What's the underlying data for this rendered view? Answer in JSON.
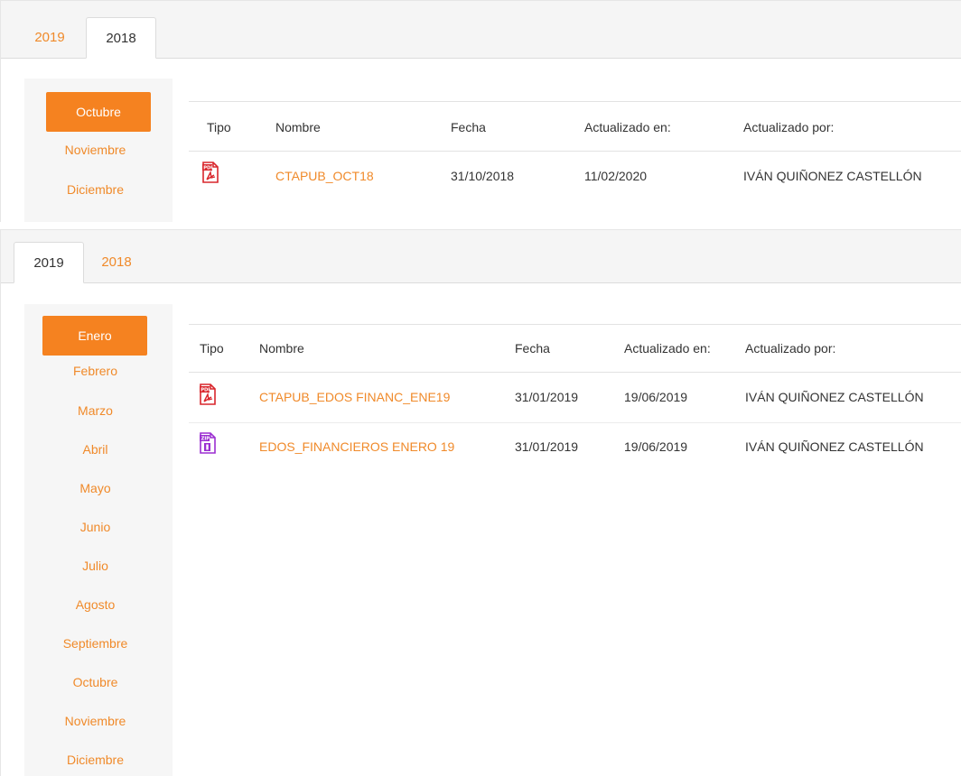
{
  "panel1": {
    "tabs": [
      {
        "label": "2019",
        "active": false
      },
      {
        "label": "2018",
        "active": true
      }
    ],
    "months": [
      "Octubre",
      "Noviembre",
      "Diciembre"
    ],
    "active_month": "Octubre",
    "columns": [
      "Tipo",
      "Nombre",
      "Fecha",
      "Actualizado en:",
      "Actualizado por:"
    ],
    "rows": [
      {
        "type": "pdf-icon",
        "nombre": "CTAPUB_OCT18",
        "fecha": "31/10/2018",
        "actualizado_en": "11/02/2020",
        "actualizado_por": "IVÁN QUIÑONEZ CASTELLÓN"
      }
    ]
  },
  "panel2": {
    "tabs": [
      {
        "label": "2019",
        "active": true
      },
      {
        "label": "2018",
        "active": false
      }
    ],
    "months": [
      "Enero",
      "Febrero",
      "Marzo",
      "Abril",
      "Mayo",
      "Junio",
      "Julio",
      "Agosto",
      "Septiembre",
      "Octubre",
      "Noviembre",
      "Diciembre"
    ],
    "active_month": "Enero",
    "columns": [
      "Tipo",
      "Nombre",
      "Fecha",
      "Actualizado en:",
      "Actualizado por:"
    ],
    "rows": [
      {
        "type": "pdf-icon",
        "nombre": "CTAPUB_EDOS FINANC_ENE19",
        "fecha": "31/01/2019",
        "actualizado_en": "19/06/2019",
        "actualizado_por": "IVÁN QUIÑONEZ CASTELLÓN"
      },
      {
        "type": "zip-icon",
        "nombre": "EDOS_FINANCIEROS ENERO 19",
        "fecha": "31/01/2019",
        "actualizado_en": "19/06/2019",
        "actualizado_por": "IVÁN QUIÑONEZ CASTELLÓN"
      }
    ]
  },
  "colors": {
    "accent": "#f58220",
    "link": "#f08a2a",
    "pdf": "#d9262c",
    "zip": "#9b2fd1"
  }
}
